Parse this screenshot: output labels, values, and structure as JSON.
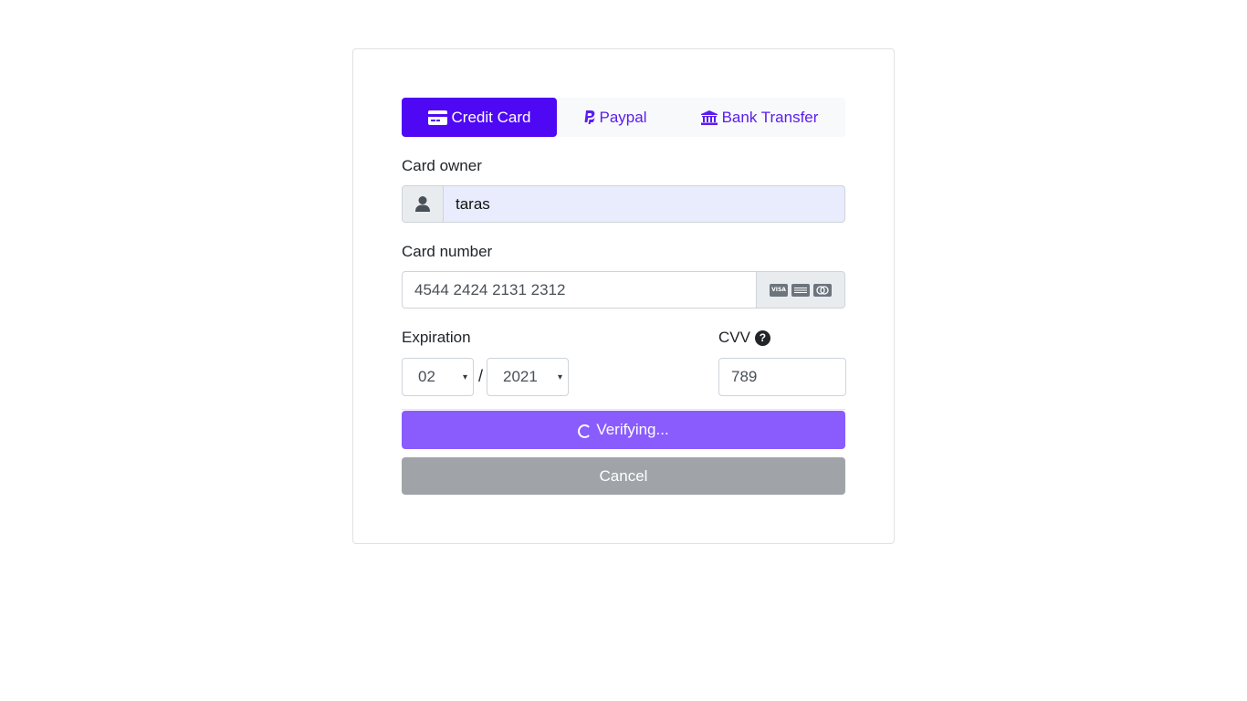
{
  "tabs": [
    {
      "label": "Credit Card",
      "icon": "credit-card-icon",
      "active": true
    },
    {
      "label": "Paypal",
      "icon": "paypal-icon",
      "active": false
    },
    {
      "label": "Bank Transfer",
      "icon": "bank-icon",
      "active": false
    }
  ],
  "owner": {
    "label": "Card owner",
    "value": "taras",
    "icon": "user-icon"
  },
  "number": {
    "label": "Card number",
    "value": "4544 2424 2131 2312",
    "brand_icons": [
      "visa-icon",
      "amex-icon",
      "mastercard-icon"
    ]
  },
  "expiration": {
    "label": "Expiration",
    "month": "02",
    "separator": "/",
    "year": "2021"
  },
  "cvv": {
    "label": "CVV",
    "value": "789",
    "help_icon": "question-circle-icon"
  },
  "actions": {
    "verify_label": "Verifying...",
    "cancel_label": "Cancel"
  },
  "colors": {
    "accent": "#4f08f3",
    "tab_text": "#5b1df0",
    "verify_bg": "#8a5cfd",
    "cancel_bg": "#a0a4a9"
  }
}
